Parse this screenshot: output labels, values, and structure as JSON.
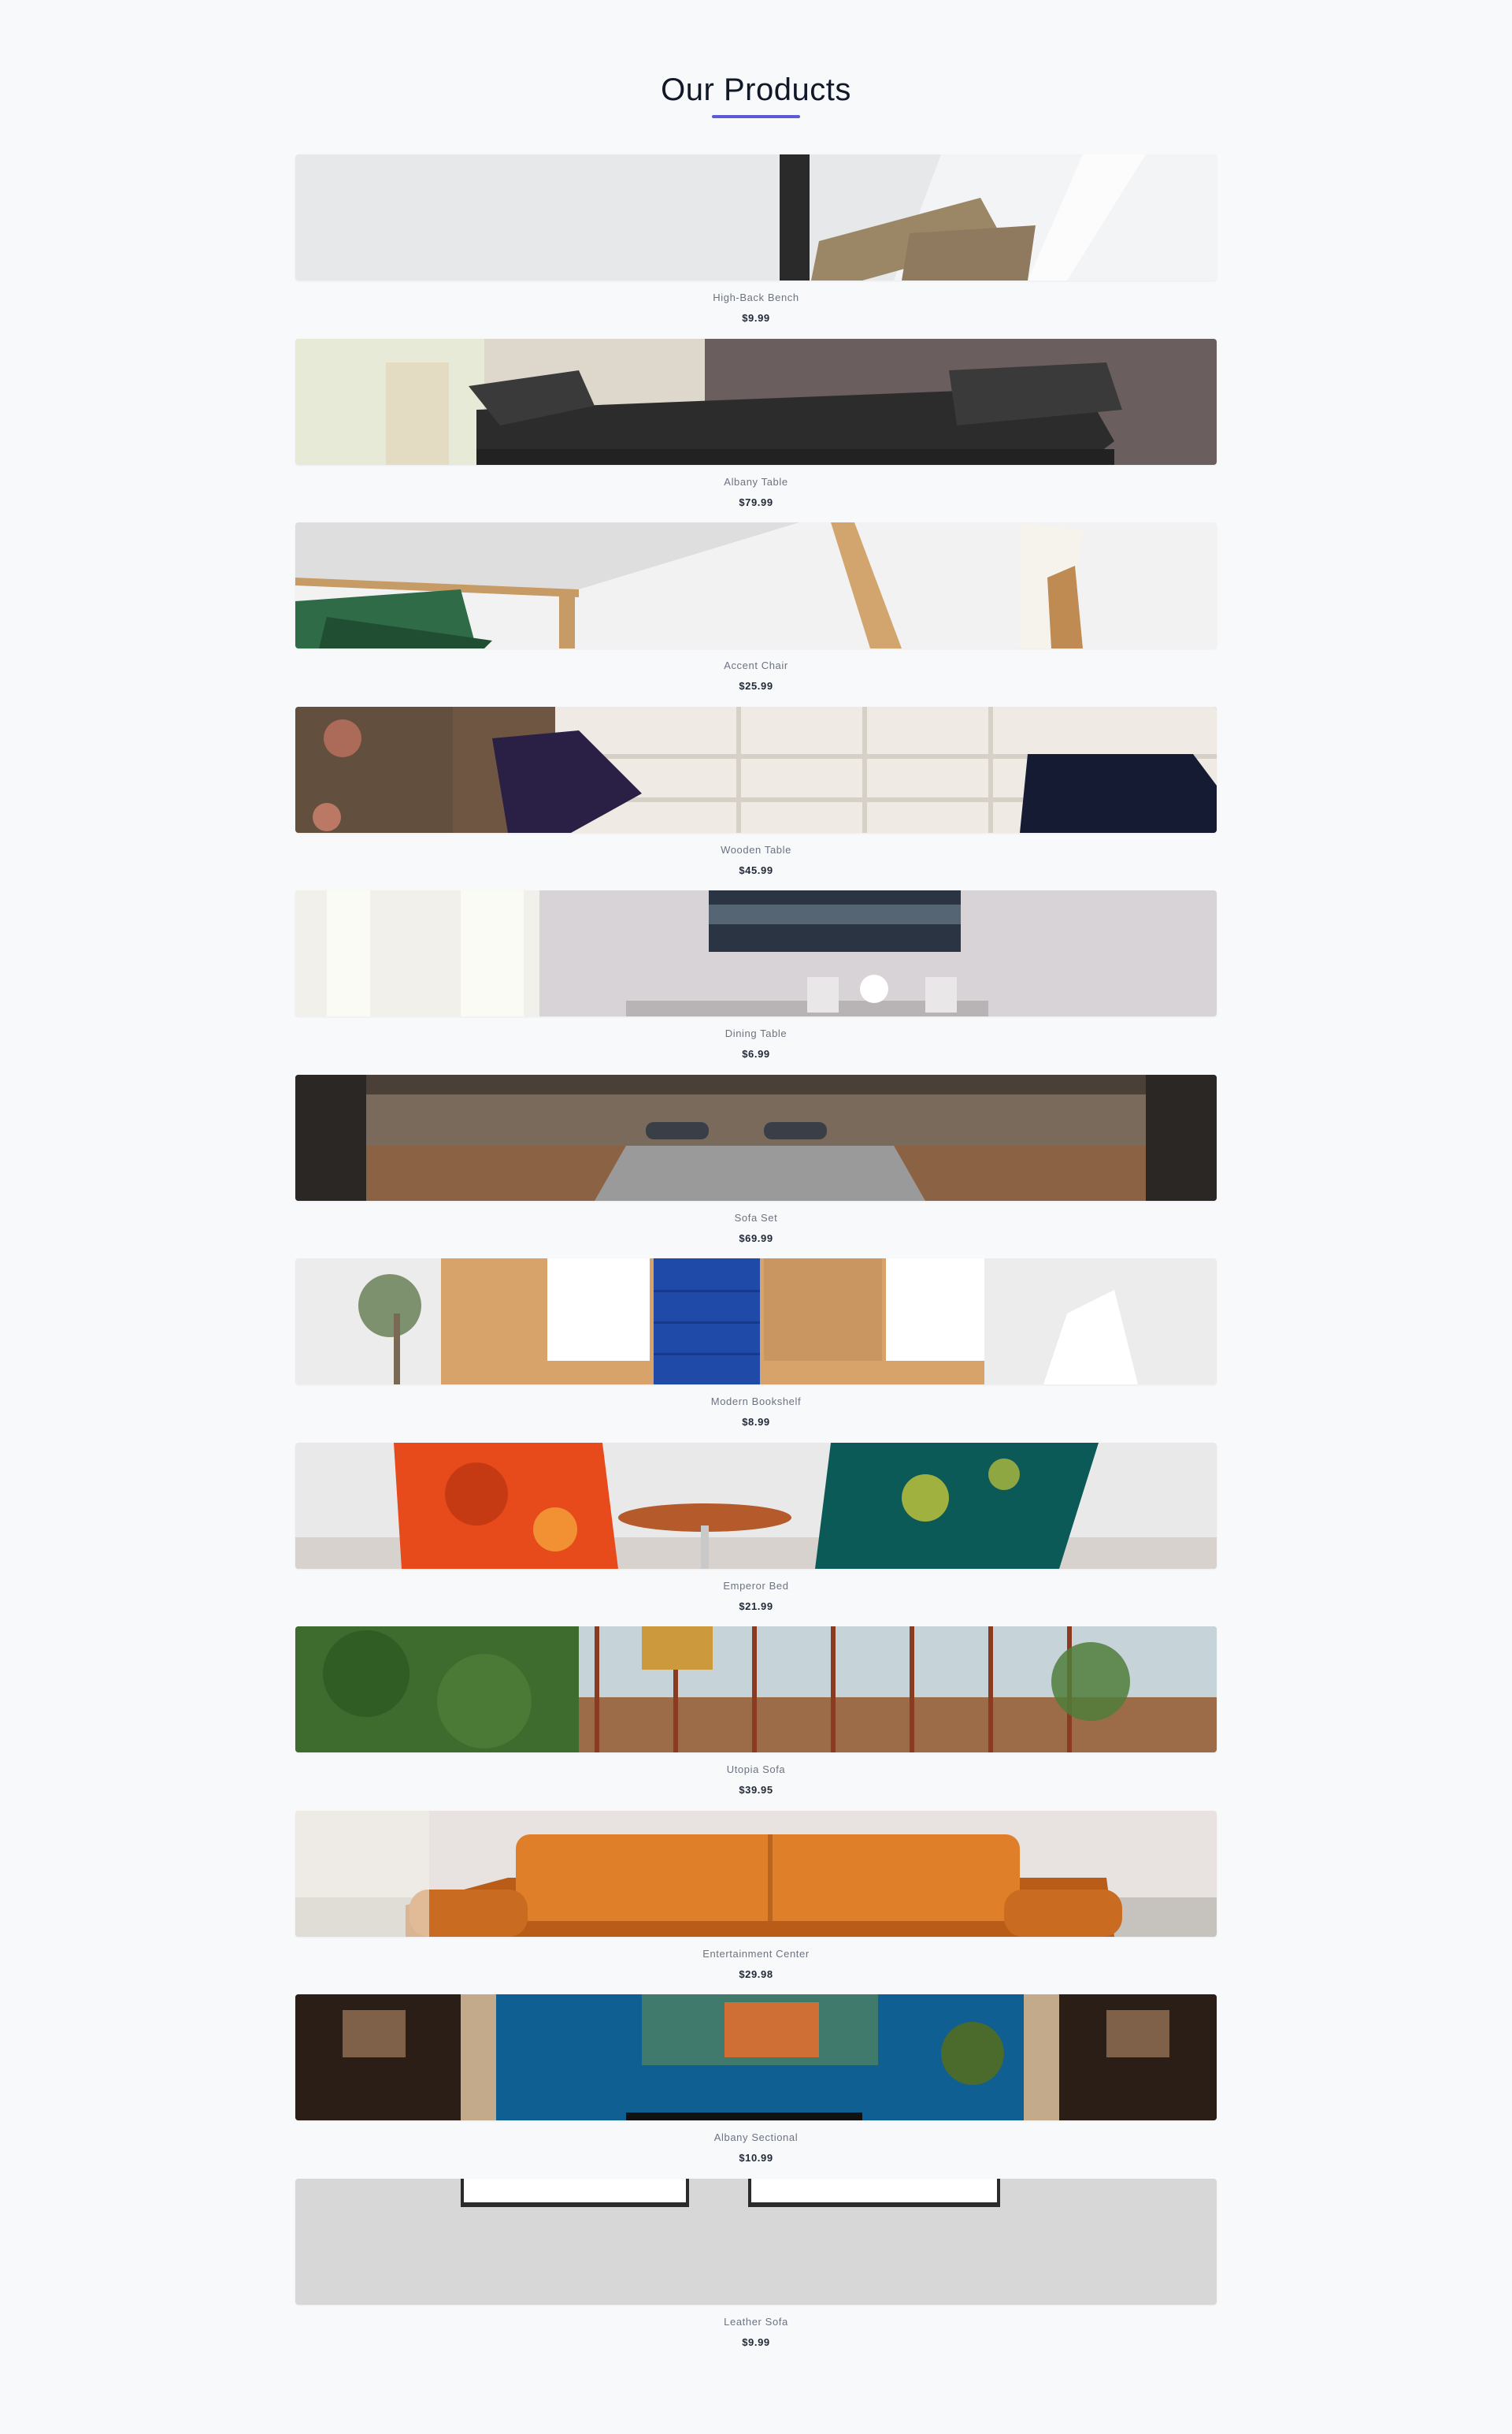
{
  "header": {
    "title": "Our Products"
  },
  "products": [
    {
      "name": "High-Back Bench",
      "price": "$9.99",
      "image_icon": "photo-icon"
    },
    {
      "name": "Albany Table",
      "price": "$79.99",
      "image_icon": "photo-icon"
    },
    {
      "name": "Accent Chair",
      "price": "$25.99",
      "image_icon": "photo-icon"
    },
    {
      "name": "Wooden Table",
      "price": "$45.99",
      "image_icon": "photo-icon"
    },
    {
      "name": "Dining Table",
      "price": "$6.99",
      "image_icon": "photo-icon"
    },
    {
      "name": "Sofa Set",
      "price": "$69.99",
      "image_icon": "photo-icon"
    },
    {
      "name": "Modern Bookshelf",
      "price": "$8.99",
      "image_icon": "photo-icon"
    },
    {
      "name": "Emperor Bed",
      "price": "$21.99",
      "image_icon": "photo-icon"
    },
    {
      "name": "Utopia Sofa",
      "price": "$39.95",
      "image_icon": "photo-icon"
    },
    {
      "name": "Entertainment Center",
      "price": "$29.98",
      "image_icon": "photo-icon"
    },
    {
      "name": "Albany Sectional",
      "price": "$10.99",
      "image_icon": "photo-icon"
    },
    {
      "name": "Leather Sofa",
      "price": "$9.99",
      "image_icon": "photo-icon"
    }
  ],
  "colors": {
    "background": "#f8f9fb",
    "accent": "#5b5bd6",
    "text": "#111827",
    "muted": "#6b7280"
  }
}
